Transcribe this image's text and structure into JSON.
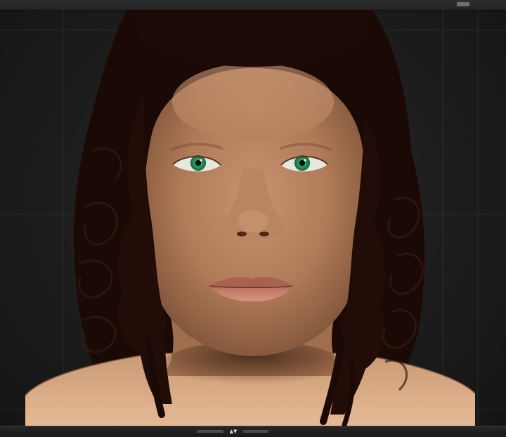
{
  "icons": {
    "tray_toggle": "up-down-arrows-icon"
  },
  "colors": {
    "background": "#1b1b1b",
    "skin": "#b98561",
    "hair": "#1e0b07",
    "iris": "#1f8a55"
  }
}
